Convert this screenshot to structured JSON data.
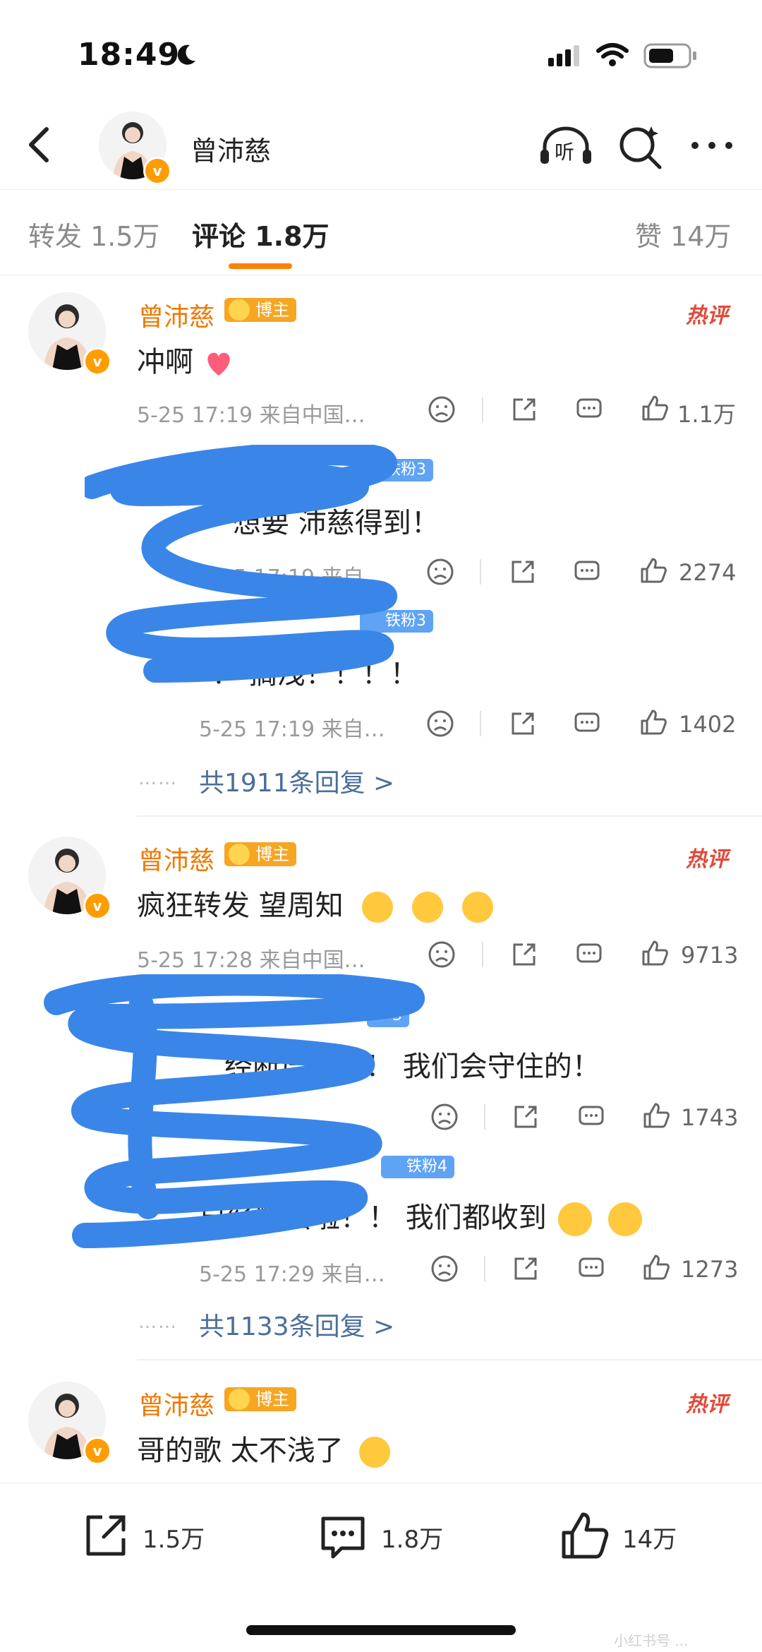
{
  "status": {
    "time": "18:49"
  },
  "header": {
    "name": "曾沛慈",
    "listen_label": "听"
  },
  "tabs": {
    "repost": "转发 1.5万",
    "comment": "评论 1.8万",
    "like": "赞 14万"
  },
  "comments": [
    {
      "name": "曾沛慈",
      "role": "博主",
      "hot": "热评",
      "text": "冲啊",
      "time": "5-25 17:19 来自中国…",
      "likes": "1.1万",
      "replies": [
        {
          "badge": "铁粉3",
          "text": "想要 沛慈得到！",
          "time": "5-25 17:19 来自…",
          "likes": "2274"
        },
        {
          "badge": "铁粉3",
          "text": "！ 搁浅！！！！",
          "time": "5-25 17:19 来自…",
          "likes": "1402"
        }
      ],
      "reply_count": "共1911条回复 >"
    },
    {
      "name": "曾沛慈",
      "role": "博主",
      "hot": "热评",
      "text": "疯狂转发 望周知",
      "time": "5-25 17:28 来自中国…",
      "likes": "9713",
      "replies": [
        {
          "badge": "3",
          "text": "经断层了！！ 我们会守住的！",
          "time": "",
          "likes": "1743"
        },
        {
          "badge": "铁粉4",
          "text": "已经断层啦！！ 我们都收到",
          "time": "5-25 17:29 来自…",
          "likes": "1273"
        }
      ],
      "reply_count": "共1133条回复 >"
    },
    {
      "name": "曾沛慈",
      "role": "博主",
      "hot": "热评",
      "text": "哥的歌 太不浅了"
    }
  ],
  "bottom": {
    "repost": "1.5万",
    "comment": "1.8万",
    "like": "14万"
  },
  "watermark": "小红书号 ..."
}
